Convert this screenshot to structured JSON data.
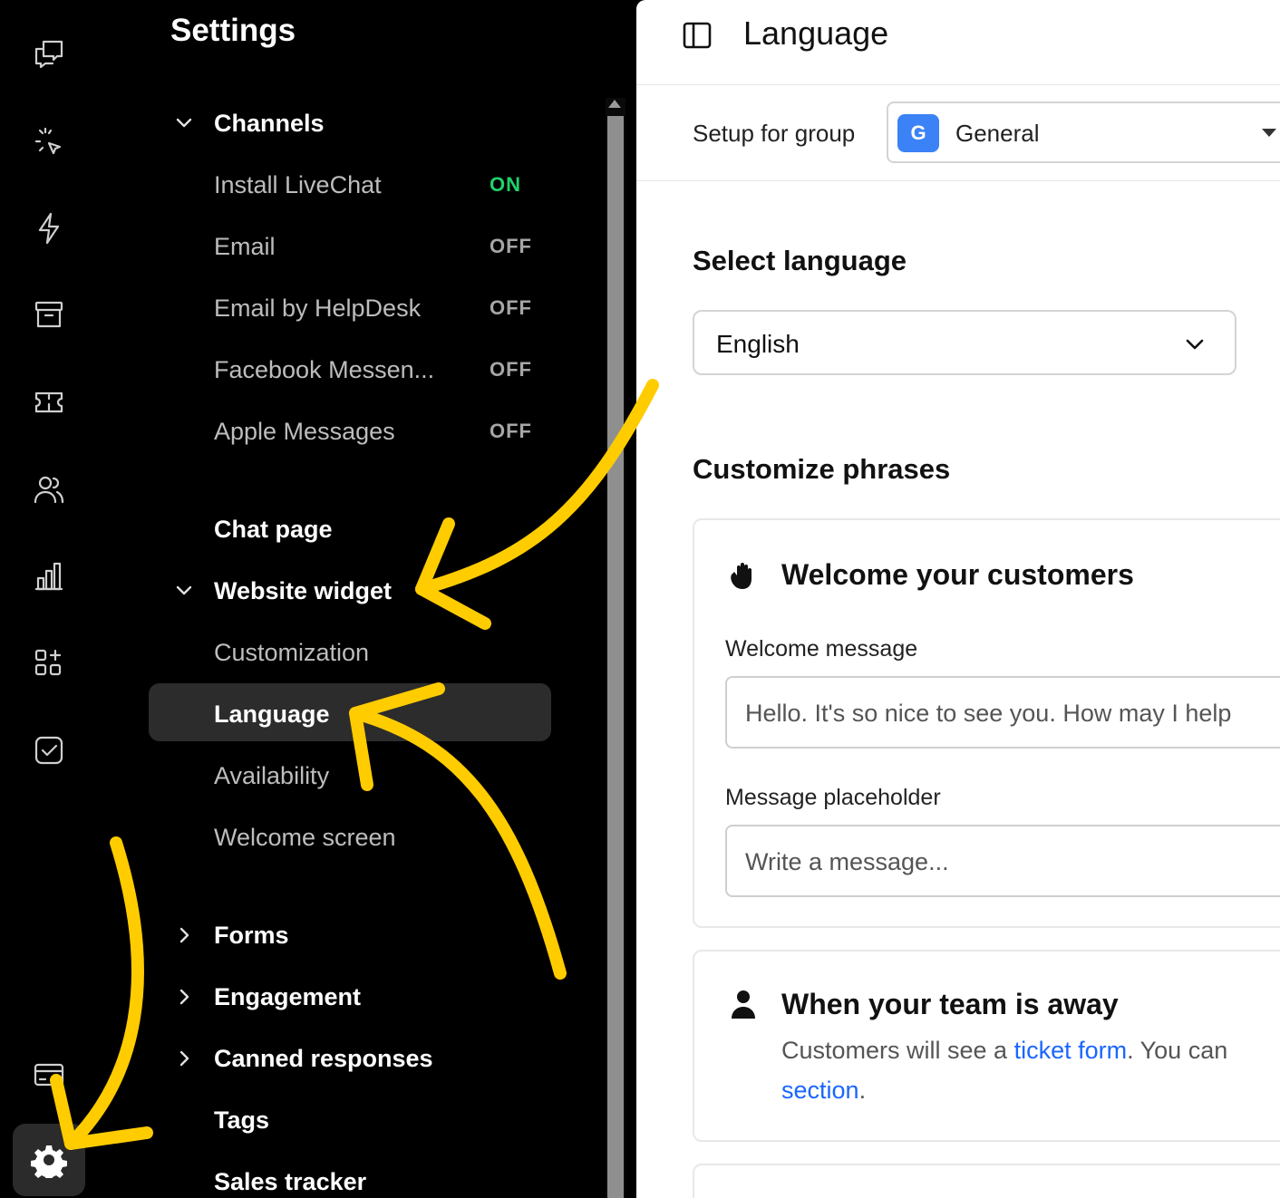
{
  "sidebar": {
    "title": "Settings",
    "sections": {
      "channels": {
        "label": "Channels",
        "items": [
          {
            "label": "Install LiveChat",
            "status": "ON"
          },
          {
            "label": "Email",
            "status": "OFF"
          },
          {
            "label": "Email by HelpDesk",
            "status": "OFF"
          },
          {
            "label": "Facebook Messen...",
            "status": "OFF"
          },
          {
            "label": "Apple Messages",
            "status": "OFF"
          }
        ]
      },
      "chat_page": {
        "label": "Chat page"
      },
      "website_widget": {
        "label": "Website widget",
        "items": [
          {
            "label": "Customization"
          },
          {
            "label": "Language"
          },
          {
            "label": "Availability"
          },
          {
            "label": "Welcome screen"
          }
        ]
      },
      "forms": {
        "label": "Forms"
      },
      "engagement": {
        "label": "Engagement"
      },
      "canned_responses": {
        "label": "Canned responses"
      },
      "tags": {
        "label": "Tags"
      },
      "sales_tracker": {
        "label": "Sales tracker"
      }
    }
  },
  "main": {
    "title": "Language",
    "group": {
      "label": "Setup for group",
      "avatar": "G",
      "value": "General"
    },
    "select_language": {
      "heading": "Select language",
      "value": "English"
    },
    "customize": {
      "heading": "Customize phrases"
    },
    "welcome_card": {
      "title": "Welcome your customers",
      "welcome_label": "Welcome message",
      "welcome_value": "Hello. It's so nice to see you. How may I help",
      "placeholder_label": "Message placeholder",
      "placeholder_value": "Write a message..."
    },
    "away_card": {
      "title": "When your team is away",
      "desc_prefix": "Customers will see a ",
      "desc_link": "ticket form",
      "desc_suffix": ". You can",
      "desc_link2": "section",
      "desc_end": "."
    }
  },
  "colors": {
    "on_status": "#1fd16a",
    "link": "#1a66ff",
    "annotation": "#ffcc00",
    "avatar": "#3b82f6"
  }
}
